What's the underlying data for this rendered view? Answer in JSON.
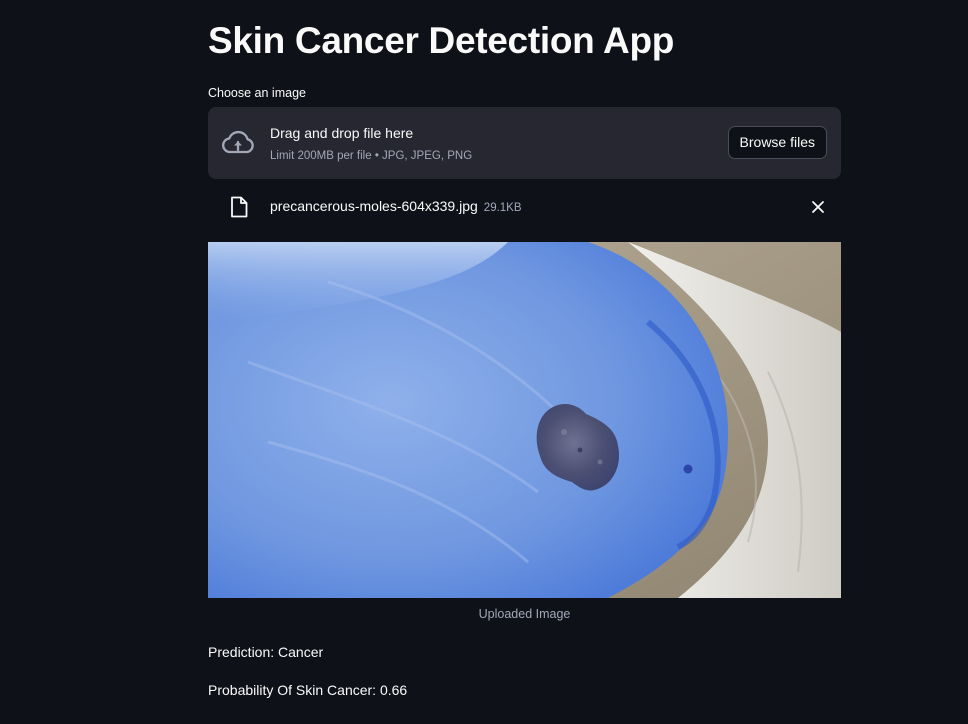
{
  "app": {
    "title": "Skin Cancer Detection App"
  },
  "uploader": {
    "label": "Choose an image",
    "drop_title": "Drag and drop file here",
    "drop_limit": "Limit 200MB per file • JPG, JPEG, PNG",
    "browse_label": "Browse files",
    "icon": "cloud-upload-icon"
  },
  "uploaded_file": {
    "name": "precancerous-moles-604x339.jpg",
    "size": "29.1KB",
    "icon": "file-icon",
    "remove_icon": "close-icon"
  },
  "image": {
    "caption": "Uploaded Image",
    "colors": {
      "skin": "#6f97e0",
      "mole": "#4b4f72",
      "fabric": "#e6e4df",
      "background": "#a89c86"
    }
  },
  "results": {
    "prediction": "Prediction: Cancer",
    "probability": "Probability Of Skin Cancer: 0.66"
  },
  "theme": {
    "background": "#0e1117",
    "panel": "#262730",
    "text": "#fafafa",
    "muted": "#a3a8b8"
  }
}
